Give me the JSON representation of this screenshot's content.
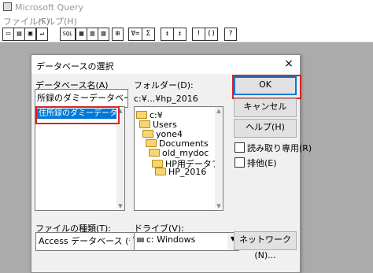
{
  "app": {
    "title": "Microsoft Query"
  },
  "menu": {
    "file": "ファイル(F)",
    "help": "ヘルプ(H)"
  },
  "toolbar": {
    "sql": "SQL",
    "sigma": "Σ",
    "excl": "!",
    "q": "?"
  },
  "dialog": {
    "title": "データベースの選択",
    "close": "×",
    "dbname_label": "データベース名(A)",
    "dbname_value": "所録のダミーデータベース.accdb",
    "file_list": [
      "住所録のダミーデータベース.accdb"
    ],
    "folder_label": "フォルダー(D):",
    "folder_path": "c:¥...¥hp_2016",
    "folder_tree": [
      "c:¥",
      "Users",
      "yone4",
      "Documents",
      "old_mydoc",
      "HP用データファイル",
      "HP_2016"
    ],
    "ok": "OK",
    "cancel": "キャンセル",
    "help": "ヘルプ(H)",
    "readonly": "読み取り専用(R)",
    "exclusive": "排他(E)",
    "filetype_label": "ファイルの種類(T):",
    "filetype_value": "Access データベース (*.mdb",
    "drive_label": "ドライブ(V):",
    "drive_value": "c: Windows",
    "network": "ネットワーク(N)..."
  }
}
